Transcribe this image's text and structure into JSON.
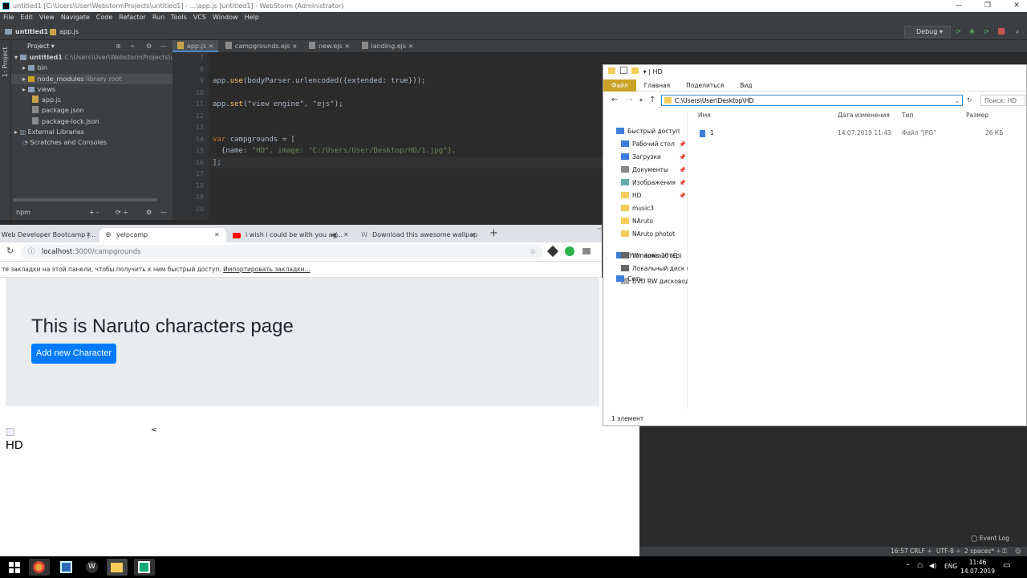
{
  "window": {
    "title": "untitled1 [C:\\Users\\User\\WebstormProjects\\untitled1] - ...\\app.js [untitled1] - WebStorm (Administrator)"
  },
  "menu": [
    "File",
    "Edit",
    "View",
    "Navigate",
    "Code",
    "Refactor",
    "Run",
    "Tools",
    "VCS",
    "Window",
    "Help"
  ],
  "nav": {
    "project": "untitled1",
    "file": "app.js",
    "run_config": "Debug"
  },
  "project_panel": {
    "label": "Project",
    "side_label": "1: Project",
    "root": "untitled1",
    "root_path": "C:\\Users\\User\\WebstormProjects\\untit",
    "items": [
      {
        "name": "bin"
      },
      {
        "name": "node_modules",
        "note": "library root"
      },
      {
        "name": "views"
      },
      {
        "name": "app.js"
      },
      {
        "name": "package.json"
      },
      {
        "name": "package-lock.json"
      },
      {
        "name": "External Libraries"
      },
      {
        "name": "Scratches and Consoles"
      }
    ],
    "npm": "npm"
  },
  "editor": {
    "tabs": [
      "app.js",
      "campgrounds.ejs",
      "new.ejs",
      "landing.ejs"
    ],
    "line_numbers": [
      "7",
      "8",
      "9",
      "10",
      "11",
      "12",
      "13",
      "14",
      "15",
      "16",
      "17",
      "18",
      "19",
      "20"
    ],
    "lines": [
      {
        "a": "",
        "b": "",
        "c": ""
      },
      {
        "a": "",
        "b": "",
        "c": ""
      },
      {
        "a": "app.",
        "b": "use",
        "c": "(bodyParser.urlencoded({extended: true}));"
      },
      {
        "a": "",
        "b": "",
        "c": ""
      },
      {
        "a": "app.",
        "b": "set",
        "c": "(\"view engine\", \"ejs\");"
      },
      {
        "a": "",
        "b": "",
        "c": ""
      },
      {
        "a": "",
        "b": "",
        "c": ""
      },
      {
        "a": "var ",
        "b": "",
        "c": "campgrounds = ["
      },
      {
        "a": "  {name: ",
        "b": "\"HD\"",
        "c": ", image: \"C:/Users/User/Desktop/HD/1.jpg\"},"
      },
      {
        "a": "];",
        "b": "",
        "c": ""
      },
      {
        "a": "",
        "b": "",
        "c": ""
      },
      {
        "a": "",
        "b": "",
        "c": ""
      },
      {
        "a": "",
        "b": "",
        "c": ""
      },
      {
        "a": "",
        "b": "",
        "c": ""
      }
    ]
  },
  "browser": {
    "tabs": [
      "Web Developer Bootcamp | ...",
      "yelpcamp",
      "i wish i could be with you ag...",
      "Download this awesome wallpap..."
    ],
    "url_host": "localhost",
    "url_path": ":3000/campgrounds",
    "bookmarks_text": "те закладки на этой панели, чтобы получить к ним быстрый доступ.",
    "bookmarks_link": "Импортировать закладки...",
    "page_title": "This is Naruto characters page",
    "button": "Add new Character",
    "image_alt": "HD",
    "lt": "<"
  },
  "explorer": {
    "title": "HD",
    "ribbon": [
      "Файл",
      "Главная",
      "Поделиться",
      "Вид"
    ],
    "path": "C:\\Users\\User\\Desktop\\HD",
    "search": "Поиск: HD",
    "nav": [
      {
        "label": "Быстрый доступ",
        "pin": false,
        "icon": "star"
      },
      {
        "label": "Рабочий стол",
        "pin": true,
        "icon": "desktop"
      },
      {
        "label": "Загрузки",
        "pin": true,
        "icon": "download"
      },
      {
        "label": "Документы",
        "pin": true,
        "icon": "doc"
      },
      {
        "label": "Изображения",
        "pin": true,
        "icon": "image"
      },
      {
        "label": "HD",
        "pin": true,
        "icon": "folder"
      },
      {
        "label": "music3",
        "pin": false,
        "icon": "folder"
      },
      {
        "label": "NAruto",
        "pin": false,
        "icon": "folder"
      },
      {
        "label": "NAruto photot",
        "pin": false,
        "icon": "folder"
      },
      {
        "label": "Этот компьютер",
        "pin": false,
        "icon": "pc"
      },
      {
        "label": "Windows 10 (C:)",
        "pin": false,
        "icon": "drive"
      },
      {
        "label": "Локальный диск (D",
        "pin": false,
        "icon": "drive"
      },
      {
        "label": "DVD RW дисковод (",
        "pin": false,
        "icon": "dvd"
      },
      {
        "label": "Сеть",
        "pin": false,
        "icon": "network"
      }
    ],
    "columns": [
      "Имя",
      "Дата изменения",
      "Тип",
      "Размер"
    ],
    "file": {
      "name": "1",
      "date": "14.07.2019 11:43",
      "type": "Файл \"JPG\"",
      "size": "26 КБ"
    },
    "status": "1 элемент"
  },
  "ide_status": {
    "event_log": "Event Log",
    "pos": "16:57",
    "crlf": "CRLF ÷",
    "enc": "UTF-8 ÷",
    "indent": "2 spaces* ÷"
  },
  "taskbar": {
    "lang": "ENG",
    "time": "11:46",
    "date": "14.07.2019"
  }
}
